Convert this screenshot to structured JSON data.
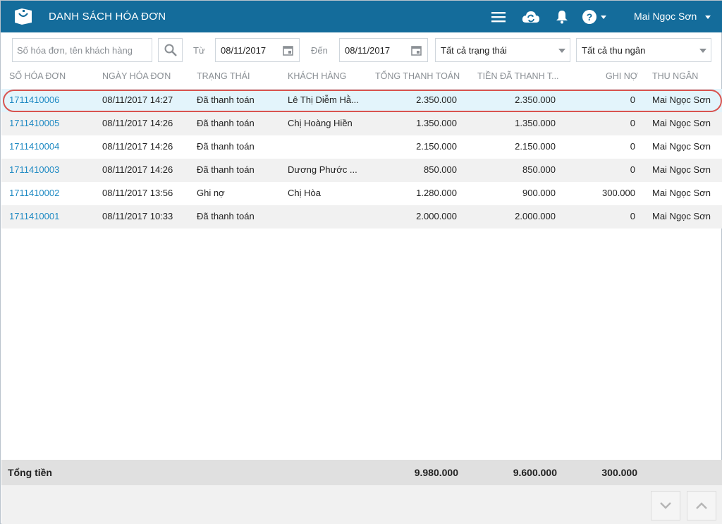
{
  "header": {
    "title": "DANH SÁCH HÓA ĐƠN",
    "user_name": "Mai Ngọc Sơn",
    "colors": {
      "header_bg": "#146c9b",
      "link": "#1f8ac3",
      "highlight": "#d9534f"
    },
    "icons": [
      "menu-icon",
      "cloud-sync-icon",
      "bell-icon",
      "help-icon"
    ]
  },
  "filters": {
    "search_placeholder": "Số hóa đơn, tên khách hàng",
    "search_value": "",
    "from_label": "Từ",
    "from_date": "08/11/2017",
    "to_label": "Đến",
    "to_date": "08/11/2017",
    "status_select": "Tất cả trạng thái",
    "cashier_select": "Tất cả thu ngân"
  },
  "table": {
    "columns": [
      "SỐ HÓA ĐƠN",
      "NGÀY HÓA ĐƠN",
      "TRẠNG THÁI",
      "KHÁCH HÀNG",
      "TỔNG THANH TOÁN",
      "TIỀN ĐÃ THANH T...",
      "GHI NỢ",
      "THU NGÂN"
    ],
    "rows": [
      {
        "invoice": "1711410006",
        "date": "08/11/2017 14:27",
        "status": "Đã thanh toán",
        "customer": "Lê Thị Diễm Hằ...",
        "total": "2.350.000",
        "paid": "2.350.000",
        "debt": "0",
        "cashier": "Mai Ngọc Sơn"
      },
      {
        "invoice": "1711410005",
        "date": "08/11/2017 14:26",
        "status": "Đã thanh toán",
        "customer": "Chị Hoàng Hiền",
        "total": "1.350.000",
        "paid": "1.350.000",
        "debt": "0",
        "cashier": "Mai Ngọc Sơn"
      },
      {
        "invoice": "1711410004",
        "date": "08/11/2017 14:26",
        "status": "Đã thanh toán",
        "customer": "",
        "total": "2.150.000",
        "paid": "2.150.000",
        "debt": "0",
        "cashier": "Mai Ngọc Sơn"
      },
      {
        "invoice": "1711410003",
        "date": "08/11/2017 14:26",
        "status": "Đã thanh toán",
        "customer": "Dương Phước ...",
        "total": "850.000",
        "paid": "850.000",
        "debt": "0",
        "cashier": "Mai Ngọc Sơn"
      },
      {
        "invoice": "1711410002",
        "date": "08/11/2017 13:56",
        "status": "Ghi nợ",
        "customer": "Chị Hòa",
        "total": "1.280.000",
        "paid": "900.000",
        "debt": "300.000",
        "cashier": "Mai Ngọc Sơn"
      },
      {
        "invoice": "1711410001",
        "date": "08/11/2017 10:33",
        "status": "Đã thanh toán",
        "customer": "",
        "total": "2.000.000",
        "paid": "2.000.000",
        "debt": "0",
        "cashier": "Mai Ngọc Sơn"
      }
    ]
  },
  "totals": {
    "label": "Tổng tiền",
    "total": "9.980.000",
    "paid": "9.600.000",
    "debt": "300.000"
  }
}
